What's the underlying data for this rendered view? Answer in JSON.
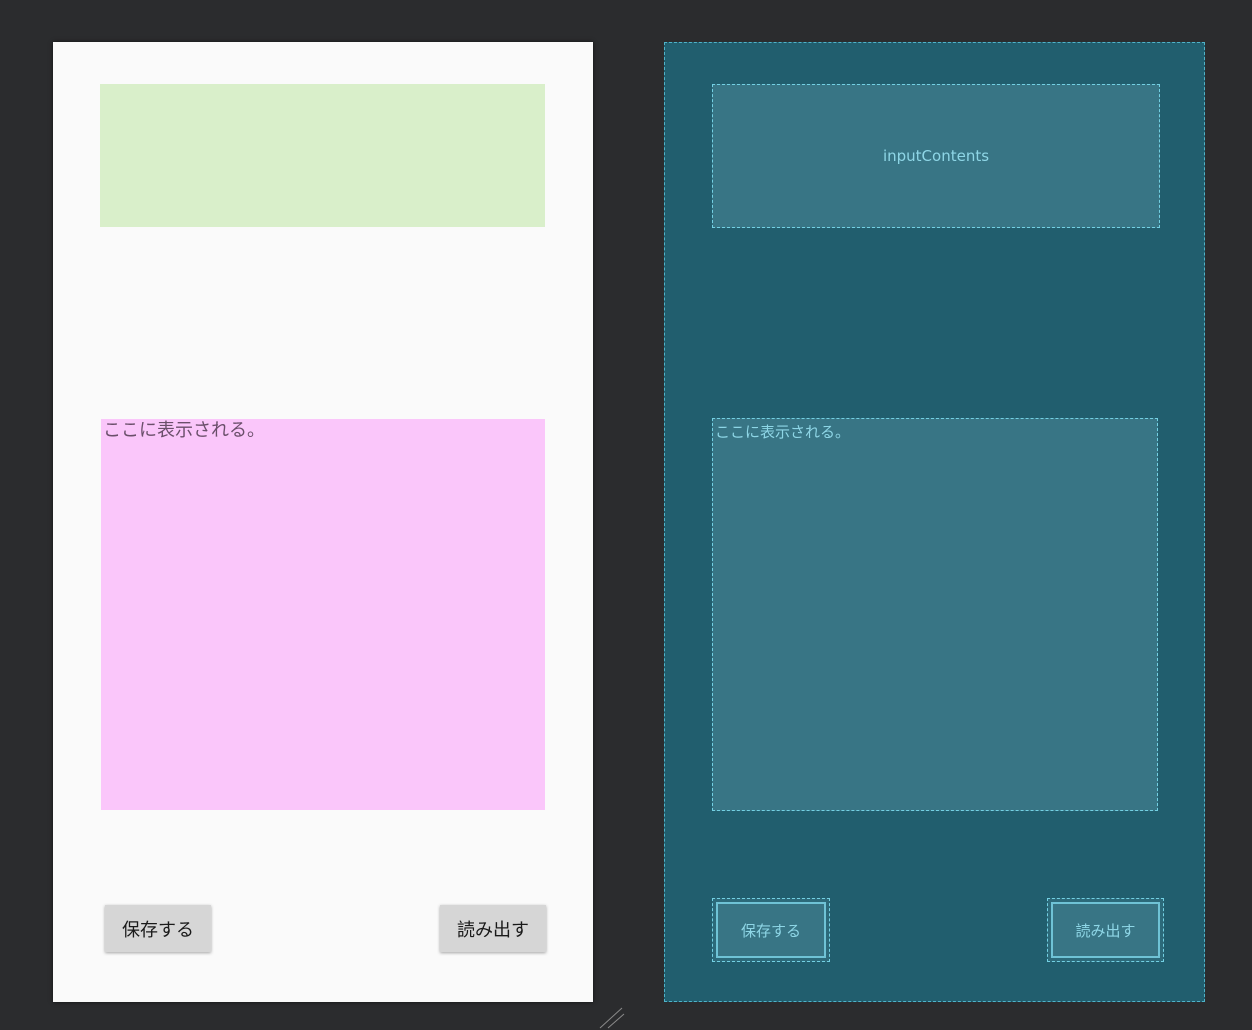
{
  "design": {
    "input": {
      "value": "",
      "placeholder": ""
    },
    "output_text": "ここに表示される。",
    "save_label": "保存する",
    "load_label": "読み出す"
  },
  "blueprint": {
    "input_id": "inputContents",
    "output_text": "ここに表示される。",
    "save_label": "保存する",
    "load_label": "読み出す"
  },
  "colors": {
    "workspace_bg": "#2b2c2e",
    "design_bg": "#fafafa",
    "input_bg": "#d9efca",
    "output_bg": "#fac6fa",
    "button_bg": "#d6d6d6",
    "blueprint_bg": "#215e6e",
    "blueprint_box": "#387585",
    "blueprint_line": "#73d0e3"
  },
  "icons": {
    "resize": "resize-handle-icon"
  }
}
